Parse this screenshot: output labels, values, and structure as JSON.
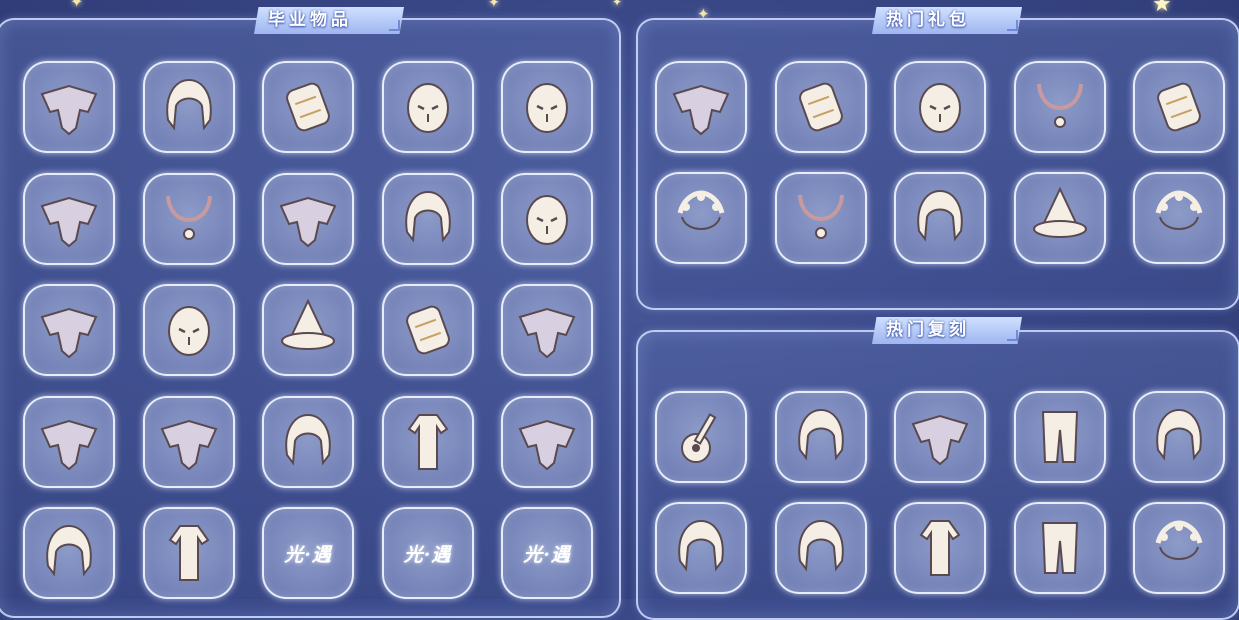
{
  "sections": {
    "graduation": {
      "title": "毕业物品"
    },
    "hot_gifts": {
      "title": "热门礼包"
    },
    "hot_recurring": {
      "title": "热门复刻"
    }
  },
  "grids": {
    "graduation": [
      [
        "cape-icon",
        "hair-icon",
        "prop-icon",
        "mask-icon",
        "mask-icon"
      ],
      [
        "cape-icon",
        "necklace-icon",
        "cape-icon",
        "hair-icon",
        "mask-icon"
      ],
      [
        "cape-icon",
        "mask-icon",
        "hat-icon",
        "prop-icon",
        "cape-icon"
      ],
      [
        "cape-icon",
        "cape-icon",
        "hair-icon",
        "outfit-icon",
        "cape-icon"
      ],
      [
        "hair-icon",
        "outfit-icon",
        "logo-placeholder",
        "logo-placeholder",
        "logo-placeholder"
      ]
    ],
    "hot_gifts": [
      [
        "cape-icon",
        "prop-icon",
        "mask-icon",
        "necklace-icon",
        "prop-icon"
      ],
      [
        "hair-accessory-icon",
        "necklace-icon",
        "hair-icon",
        "hat-icon",
        "hair-accessory-icon"
      ]
    ],
    "hot_recurring": [
      [
        "guitar-icon",
        "hair-icon",
        "cape-icon",
        "pants-icon",
        "hair-icon"
      ],
      [
        "hair-icon",
        "hair-icon",
        "outfit-icon",
        "pants-icon",
        "hair-accessory-icon"
      ]
    ]
  },
  "logo_text": "光·遇",
  "colors": {
    "background": "#3a4888",
    "slot_border": "#ecf2ff",
    "tab_fill": "#b8ccf6"
  }
}
